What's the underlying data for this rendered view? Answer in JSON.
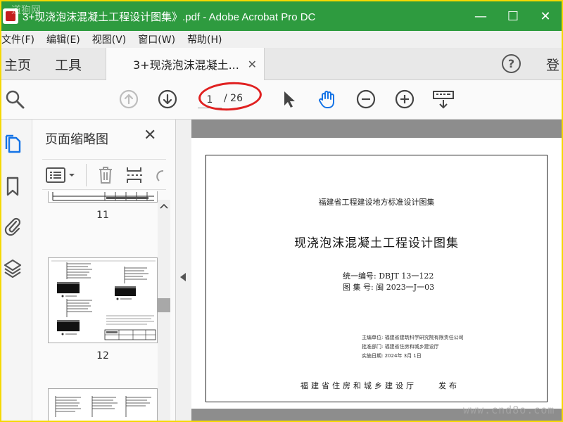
{
  "window": {
    "title": "3+现浇泡沫混凝土工程设计图集》.pdf - Adobe Acrobat Pro DC",
    "watermark_top": "道狗网",
    "minimize": "—",
    "maximize": "☐",
    "close": "✕"
  },
  "menu": {
    "items": [
      "文件(F)",
      "编辑(E)",
      "视图(V)",
      "窗口(W)",
      "帮助(H)"
    ]
  },
  "tabs": {
    "home": "主页",
    "tools": "工具",
    "document": "3+现浇泡沫混凝土...",
    "document_close": "✕",
    "help": "?",
    "login": "登"
  },
  "toolbar": {
    "current_page": "1",
    "total_pages": "/ 26"
  },
  "thumbnails": {
    "title": "页面缩略图",
    "close": "✕",
    "pages": [
      {
        "number": "11"
      },
      {
        "number": "12"
      }
    ]
  },
  "document": {
    "header": "福建省工程建设地方标准设计图集",
    "title": "现浇泡沫混凝土工程设计图集",
    "code_line": "统一编号: DBJT 13一122",
    "atlas_line": "图 集 号: 闽 2023一J一03",
    "editor_line": "主编单位:     福建省建筑科学研究院有限责任公司",
    "approver_line": "批准部门:     福建省住房和城乡建设厅",
    "date_line": "实施日期:     2024年 3月 1日",
    "publisher": "福建省住房和城乡建设厅",
    "publish_word": "发布"
  },
  "watermark_bottom": "www.cnd8o.com",
  "colors": {
    "titlebar": "#2e9b3f",
    "accent_blue": "#1473e6",
    "annotation_red": "#e02020"
  }
}
